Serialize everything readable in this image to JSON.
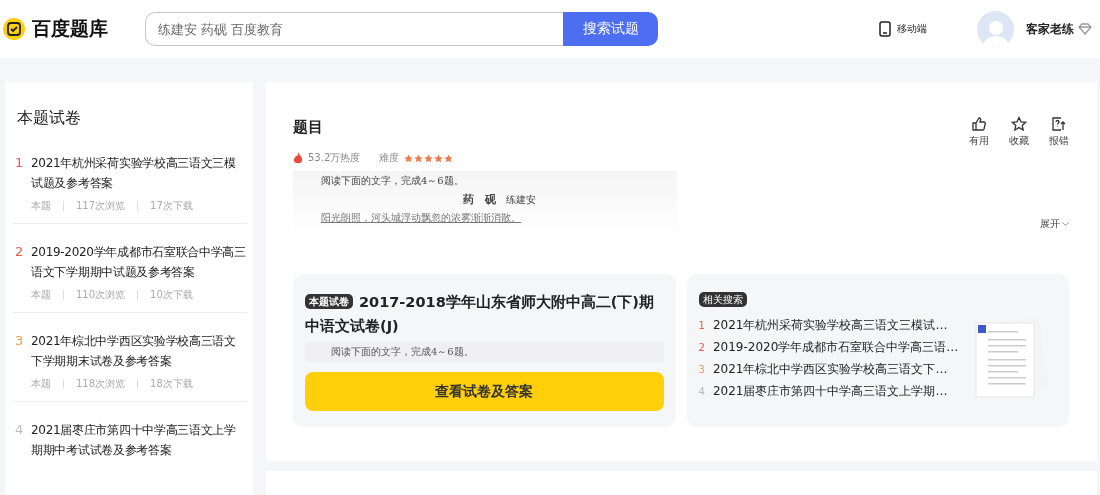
{
  "header": {
    "logo": "百度题库",
    "search": {
      "placeholder": "练建安 药砚 百度教育",
      "button": "搜索试题"
    },
    "mobile_link": "移动端",
    "user_name": "客家老练"
  },
  "sidebar": {
    "title": "本题试卷",
    "items": [
      {
        "rank": "1",
        "color": "#e85a4f",
        "title": "2021年杭州采荷实验学校高三语文三模试题及参考答案",
        "meta": [
          "本题",
          "117次浏览",
          "17次下载"
        ]
      },
      {
        "rank": "2",
        "color": "#e85a4f",
        "title": "2019-2020学年成都市石室联合中学高三语文下学期期中试题及参考答案",
        "meta": [
          "本题",
          "110次浏览",
          "10次下载"
        ]
      },
      {
        "rank": "3",
        "color": "#f0a050",
        "title": "2021年棕北中学西区实验学校高三语文下学期期末试卷及参考答案",
        "meta": [
          "本题",
          "118次浏览",
          "18次下载"
        ]
      },
      {
        "rank": "4",
        "color": "#bbbbbb",
        "title": "2021届枣庄市第四十中学高三语文上学期期中考试试卷及参考答案"
      }
    ]
  },
  "question": {
    "title": "题目",
    "heat": "53.2万热度",
    "difficulty_label": "难度",
    "stars": 5,
    "actions": [
      {
        "kind": "like",
        "label": "有用"
      },
      {
        "kind": "star",
        "label": "收藏"
      },
      {
        "kind": "report",
        "label": "报错"
      }
    ],
    "document": {
      "instruction": "阅读下面的文字，完成4～6题。",
      "heading": "药　砚",
      "author": "练建安",
      "first_line": "阳光朗照，河头城浮动飘忽的浓雾渐渐消散。"
    },
    "expand": "展开"
  },
  "paper_card": {
    "tag": "本题试卷",
    "title": "2017-2018学年山东省师大附中高二(下)期中语文试卷(J)",
    "snippet": "阅读下面的文字，完成4～6题。",
    "button": "查看试卷及答案"
  },
  "related": {
    "tag": "相关搜索",
    "items": [
      {
        "rank": "1",
        "color": "#e85a4f",
        "title": "2021年杭州采荷实验学校高三语文三模试…"
      },
      {
        "rank": "2",
        "color": "#e85a4f",
        "title": "2019-2020学年成都市石室联合中学高三语…"
      },
      {
        "rank": "3",
        "color": "#f0a050",
        "title": "2021年棕北中学西区实验学校高三语文下…"
      },
      {
        "rank": "4",
        "color": "#bbbbbb",
        "title": "2021届枣庄市第四十中学高三语文上学期…"
      }
    ]
  }
}
